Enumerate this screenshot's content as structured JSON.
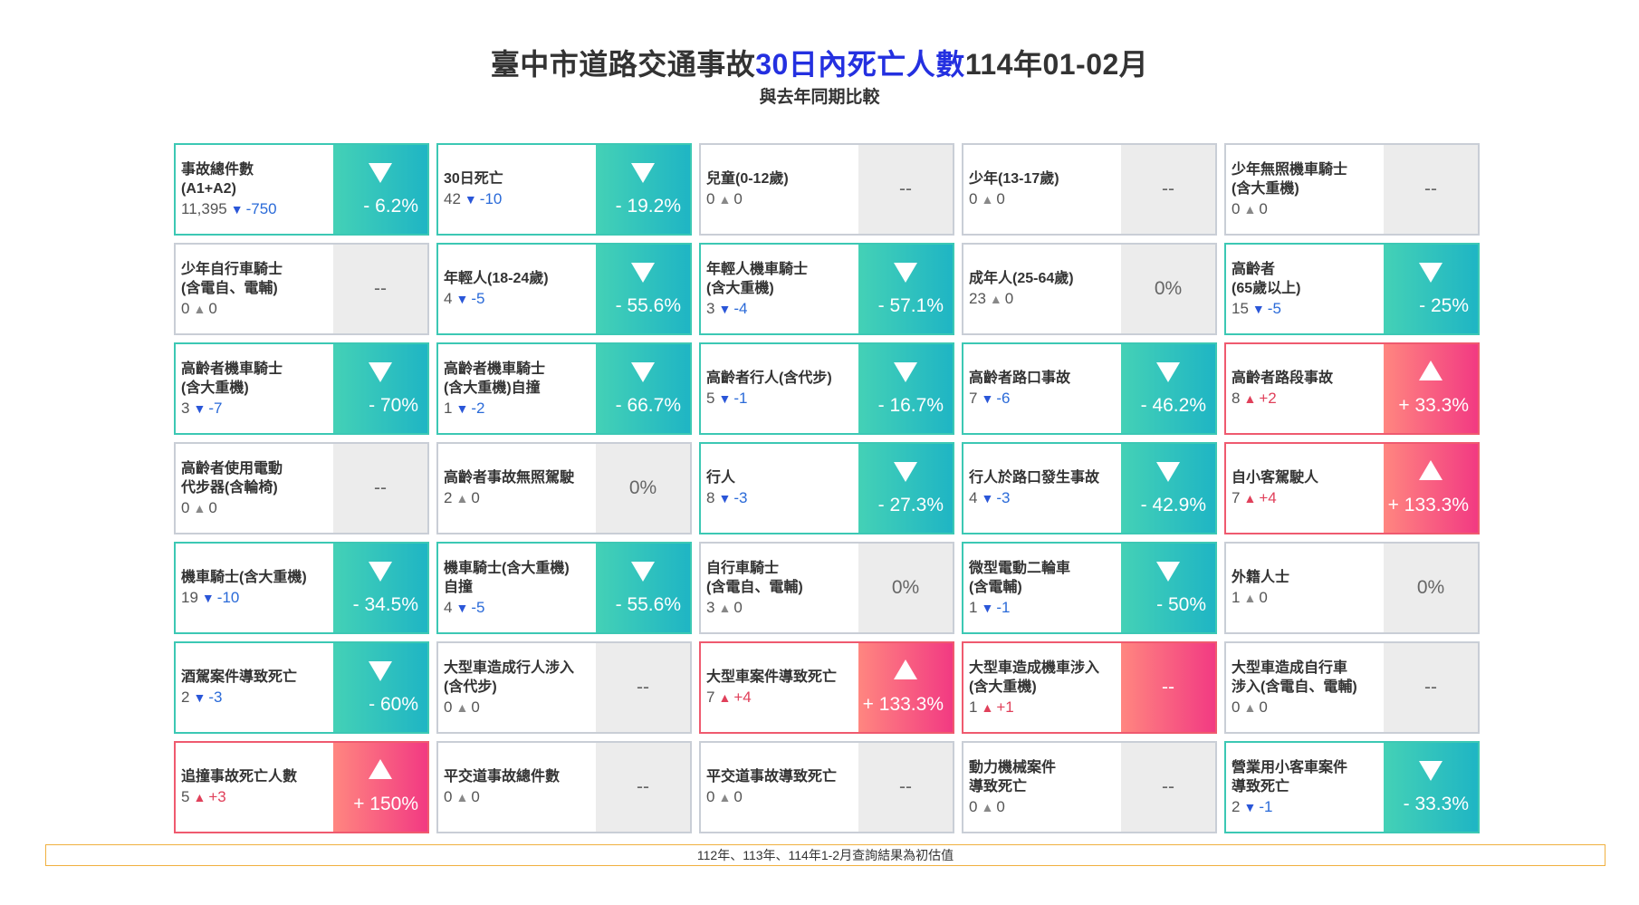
{
  "header": {
    "title_pre": "臺中市道路交通事故",
    "title_hl": "30日內死亡人數",
    "title_post": "114年01-02月",
    "subtitle": "與去年同期比較"
  },
  "colors": {
    "accent": "#2430e0",
    "down": "#3cc8b4",
    "up": "#ef5a6f",
    "neutral": "#ececec",
    "footnote_border": "#f0b040"
  },
  "cards": [
    {
      "label": "事故總件數\n(A1+A2)",
      "count": "11,395",
      "arrow": "▼",
      "change": "-750",
      "trend": "down",
      "pct": "- 6.2%"
    },
    {
      "label": "30日死亡",
      "count": "42",
      "arrow": "▼",
      "change": "-10",
      "trend": "down",
      "pct": "- 19.2%"
    },
    {
      "label": "兒童(0-12歲)",
      "count": "0",
      "arrow": "▲",
      "change": "0",
      "trend": "neutral",
      "pct": "--"
    },
    {
      "label": "少年(13-17歲)",
      "count": "0",
      "arrow": "▲",
      "change": "0",
      "trend": "neutral",
      "pct": "--"
    },
    {
      "label": "少年無照機車騎士\n(含大重機)",
      "count": "0",
      "arrow": "▲",
      "change": "0",
      "trend": "neutral",
      "pct": "--"
    },
    {
      "label": "少年自行車騎士\n(含電自、電輔)",
      "count": "0",
      "arrow": "▲",
      "change": "0",
      "trend": "neutral",
      "pct": "--"
    },
    {
      "label": "年輕人(18-24歲)",
      "count": "4",
      "arrow": "▼",
      "change": "-5",
      "trend": "down",
      "pct": "- 55.6%"
    },
    {
      "label": "年輕人機車騎士\n(含大重機)",
      "count": "3",
      "arrow": "▼",
      "change": "-4",
      "trend": "down",
      "pct": "- 57.1%"
    },
    {
      "label": "成年人(25-64歲)",
      "count": "23",
      "arrow": "▲",
      "change": "0",
      "trend": "neutral",
      "pct": "0%"
    },
    {
      "label": "高齡者\n(65歲以上)",
      "count": "15",
      "arrow": "▼",
      "change": "-5",
      "trend": "down",
      "pct": "- 25%"
    },
    {
      "label": "高齡者機車騎士\n(含大重機)",
      "count": "3",
      "arrow": "▼",
      "change": "-7",
      "trend": "down",
      "pct": "- 70%"
    },
    {
      "label": "高齡者機車騎士\n(含大重機)自撞",
      "count": "1",
      "arrow": "▼",
      "change": "-2",
      "trend": "down",
      "pct": "- 66.7%"
    },
    {
      "label": "高齡者行人(含代步)",
      "count": "5",
      "arrow": "▼",
      "change": "-1",
      "trend": "down",
      "pct": "- 16.7%"
    },
    {
      "label": "高齡者路口事故",
      "count": "7",
      "arrow": "▼",
      "change": "-6",
      "trend": "down",
      "pct": "- 46.2%"
    },
    {
      "label": "高齡者路段事故",
      "count": "8",
      "arrow": "▲",
      "change": "+2",
      "trend": "up",
      "pct": "+ 33.3%"
    },
    {
      "label": "高齡者使用電動\n代步器(含輪椅)",
      "count": "0",
      "arrow": "▲",
      "change": "0",
      "trend": "neutral",
      "pct": "--"
    },
    {
      "label": "高齡者事故無照駕駛",
      "count": "2",
      "arrow": "▲",
      "change": "0",
      "trend": "neutral",
      "pct": "0%"
    },
    {
      "label": "行人",
      "count": "8",
      "arrow": "▼",
      "change": "-3",
      "trend": "down",
      "pct": "- 27.3%"
    },
    {
      "label": "行人於路口發生事故",
      "count": "4",
      "arrow": "▼",
      "change": "-3",
      "trend": "down",
      "pct": "- 42.9%"
    },
    {
      "label": "自小客駕駛人",
      "count": "7",
      "arrow": "▲",
      "change": "+4",
      "trend": "up",
      "pct": "+ 133.3%"
    },
    {
      "label": "機車騎士(含大重機)",
      "count": "19",
      "arrow": "▼",
      "change": "-10",
      "trend": "down",
      "pct": "- 34.5%"
    },
    {
      "label": "機車騎士(含大重機)\n自撞",
      "count": "4",
      "arrow": "▼",
      "change": "-5",
      "trend": "down",
      "pct": "- 55.6%"
    },
    {
      "label": "自行車騎士\n(含電自、電輔)",
      "count": "3",
      "arrow": "▲",
      "change": "0",
      "trend": "neutral",
      "pct": "0%"
    },
    {
      "label": "微型電動二輪車\n(含電輔)",
      "count": "1",
      "arrow": "▼",
      "change": "-1",
      "trend": "down",
      "pct": "- 50%"
    },
    {
      "label": "外籍人士",
      "count": "1",
      "arrow": "▲",
      "change": "0",
      "trend": "neutral",
      "pct": "0%"
    },
    {
      "label": "酒駕案件導致死亡",
      "count": "2",
      "arrow": "▼",
      "change": "-3",
      "trend": "down",
      "pct": "- 60%"
    },
    {
      "label": "大型車造成行人涉入\n(含代步)",
      "count": "0",
      "arrow": "▲",
      "change": "0",
      "trend": "neutral",
      "pct": "--"
    },
    {
      "label": "大型車案件導致死亡",
      "count": "7",
      "arrow": "▲",
      "change": "+4",
      "trend": "up",
      "pct": "+ 133.3%"
    },
    {
      "label": "大型車造成機車涉入\n(含大重機)",
      "count": "1",
      "arrow": "▲",
      "change": "+1",
      "trend": "up-dash",
      "pct": "--"
    },
    {
      "label": "大型車造成自行車\n涉入(含電自、電輔)",
      "count": "0",
      "arrow": "▲",
      "change": "0",
      "trend": "neutral",
      "pct": "--"
    },
    {
      "label": "追撞事故死亡人數",
      "count": "5",
      "arrow": "▲",
      "change": "+3",
      "trend": "up",
      "pct": "+ 150%"
    },
    {
      "label": "平交道事故總件數",
      "count": "0",
      "arrow": "▲",
      "change": "0",
      "trend": "neutral",
      "pct": "--"
    },
    {
      "label": "平交道事故導致死亡",
      "count": "0",
      "arrow": "▲",
      "change": "0",
      "trend": "neutral",
      "pct": "--"
    },
    {
      "label": "動力機械案件\n導致死亡",
      "count": "0",
      "arrow": "▲",
      "change": "0",
      "trend": "neutral",
      "pct": "--"
    },
    {
      "label": "營業用小客車案件\n導致死亡",
      "count": "2",
      "arrow": "▼",
      "change": "-1",
      "trend": "down",
      "pct": "- 33.3%"
    }
  ],
  "footnote": "112年、113年、114年1-2月查詢結果為初估值"
}
